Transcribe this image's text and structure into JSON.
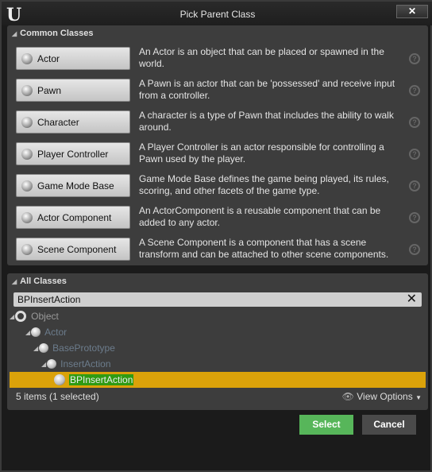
{
  "window": {
    "title": "Pick Parent Class",
    "logo": "U",
    "close": "✕"
  },
  "common": {
    "header": "Common Classes",
    "items": [
      {
        "label": "Actor",
        "desc": "An Actor is an object that can be placed or spawned in the world."
      },
      {
        "label": "Pawn",
        "desc": "A Pawn is an actor that can be 'possessed' and receive input from a controller."
      },
      {
        "label": "Character",
        "desc": "A character is a type of Pawn that includes the ability to walk around."
      },
      {
        "label": "Player Controller",
        "desc": "A Player Controller is an actor responsible for controlling a Pawn used by the player."
      },
      {
        "label": "Game Mode Base",
        "desc": "Game Mode Base defines the game being played, its rules, scoring, and other facets of the game type."
      },
      {
        "label": "Actor Component",
        "desc": "An ActorComponent is a reusable component that can be added to any actor."
      },
      {
        "label": "Scene Component",
        "desc": "A Scene Component is a component that has a scene transform and can be attached to other scene components."
      }
    ]
  },
  "all": {
    "header": "All Classes",
    "search": "BPInsertAction",
    "tree": [
      "Object",
      "Actor",
      "BasePrototype",
      "InsertAction",
      "BPInsertAction"
    ],
    "status": "5 items (1 selected)",
    "view_options": "View Options"
  },
  "actions": {
    "select": "Select",
    "cancel": "Cancel"
  },
  "colors": {
    "selected_row": "#dba20a",
    "select_button": "#57b65a",
    "highlight": "#2f9b12"
  }
}
